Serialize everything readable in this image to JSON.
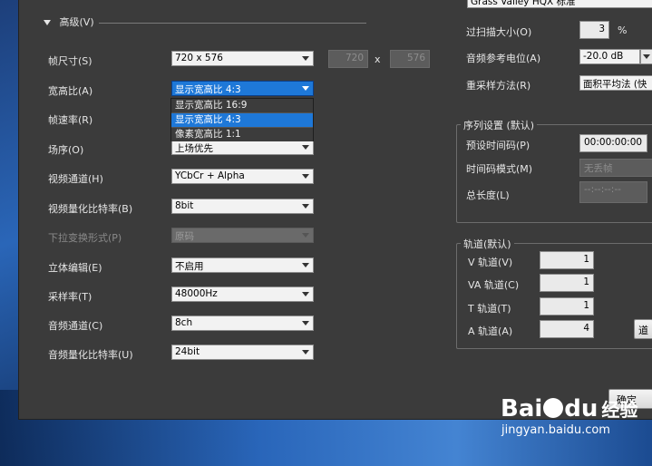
{
  "advanced": {
    "title": "高级(V)",
    "fields": [
      {
        "label": "帧尺寸(S)",
        "value": "720 x 576"
      },
      {
        "label": "宽高比(A)",
        "value": "显示宽高比 4:3"
      },
      {
        "label": "帧速率(R)",
        "value": ""
      },
      {
        "label": "场序(O)",
        "value": "上场优先"
      },
      {
        "label": "视频通道(H)",
        "value": "YCbCr + Alpha"
      },
      {
        "label": "视频量化比特率(B)",
        "value": "8bit"
      },
      {
        "label": "下拉变换形式(P)",
        "value": "原码"
      },
      {
        "label": "立体编辑(E)",
        "value": "不启用"
      },
      {
        "label": "采样率(T)",
        "value": "48000Hz"
      },
      {
        "label": "音频通道(C)",
        "value": "8ch"
      },
      {
        "label": "音频量化比特率(U)",
        "value": "24bit"
      }
    ],
    "frame_width": "720",
    "frame_x": "x",
    "frame_height": "576",
    "aspect_options": [
      "显示宽高比 16:9",
      "显示宽高比 4:3",
      "像素宽高比 1:1"
    ],
    "aspect_selected_index": 1
  },
  "right_top": {
    "codec": "Grass Valley HQX 标准",
    "overscan_label": "过扫描大小(O)",
    "overscan_value": "3",
    "overscan_unit": "%",
    "audio_ref_label": "音频参考电位(A)",
    "audio_ref_value": "-20.0 dB",
    "resample_label": "重采样方法(R)",
    "resample_value": "面积平均法 (快"
  },
  "sequence": {
    "title": "序列设置 (默认)",
    "preset_tc_label": "预设时间码(P)",
    "preset_tc_value": "00:00:00:00",
    "tc_mode_label": "时间码模式(M)",
    "tc_mode_value": "无丢帧",
    "length_label": "总长度(L)",
    "length_value": "--:--:--:--"
  },
  "tracks": {
    "title": "轨道(默认)",
    "items": [
      {
        "label": "V 轨道(V)",
        "value": "1"
      },
      {
        "label": "VA 轨道(C)",
        "value": "1"
      },
      {
        "label": "T 轨道(T)",
        "value": "1"
      },
      {
        "label": "A 轨道(A)",
        "value": "4"
      }
    ],
    "side_button": "道"
  },
  "footer": {
    "ok_label": "确定"
  },
  "watermark": {
    "brand_a": "Bai",
    "brand_b": "du",
    "brand_c": "经验",
    "url": "jingyan.baidu.com"
  }
}
